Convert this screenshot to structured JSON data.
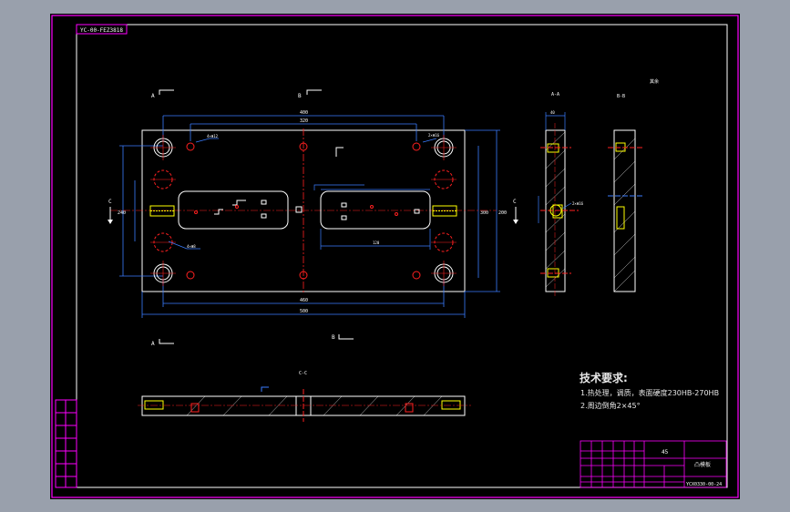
{
  "sheet": {
    "title_block_code": "YC-00-FEZ3818",
    "drawing_number": "YCX0330-00-24",
    "part_name": "凸模板",
    "material": "45",
    "scale_note": "其余"
  },
  "views": {
    "section_aa": "A-A",
    "section_bb": "B-B",
    "section_cc": "C-C",
    "marker_a": "A",
    "marker_b": "B",
    "marker_c": "C"
  },
  "dimensions": {
    "overall_length": "400",
    "hole_pitch_top": "320",
    "hole_pitch_inner": "300",
    "bottom_length": "460",
    "bottom_overall": "500",
    "height_right": "200",
    "height_left": "240",
    "slot_length": "120",
    "hole_note_1": "4×Φ12",
    "hole_note_2": "2×Φ16",
    "hole_note_3": "4×Φ8",
    "side_dim": "70",
    "section_dim": "40"
  },
  "tech_requirements": {
    "heading": "技术要求:",
    "line1": "1.热处理，调质，表面硬度230HB-270HB",
    "line2": "2.周边倒角2×45°"
  },
  "left_strip_labels": [
    "",
    "",
    "",
    "",
    "",
    "",
    ""
  ],
  "colors": {
    "border": "#ff00ff",
    "outline": "#ffffff",
    "dimension": "#3a7dff",
    "center": "#ff2020",
    "hidden": "#ffff00"
  }
}
